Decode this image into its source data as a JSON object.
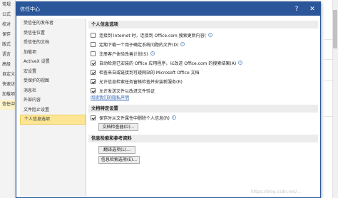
{
  "background": {
    "nav_items": [
      "常规",
      "公式",
      "校对",
      "保存",
      "版式",
      "语言",
      "高级",
      "自定义",
      "快速访问",
      "加载项",
      "信任中心"
    ],
    "selected_index": 10
  },
  "dialog": {
    "title": "信任中心",
    "help_icon": "?",
    "close_icon": "✕"
  },
  "nav": {
    "items": [
      "受信任的发布者",
      "受信任位置",
      "受信任的文档",
      "加载项",
      "ActiveX 设置",
      "宏设置",
      "受保护的视图",
      "消息栏",
      "外部内容",
      "文件阻止设置",
      "个人信息选项"
    ],
    "selected_index": 10
  },
  "personal": {
    "header": "个人信息选项",
    "options": [
      {
        "label": "连接到 Internet 时，连接到 Office.com 搜索更新内容(",
        "checked": false,
        "info": true
      },
      {
        "label": "定期下载一个用于确定系统问题的文件(D)",
        "checked": false,
        "info": true
      },
      {
        "label": "注册客户体验改善计划(S)",
        "checked": false,
        "info": true
      },
      {
        "label": "自动检测已安装的 Office 应用程序，以改进 Office.com 的搜索结果(A)",
        "checked": true,
        "info": true
      },
      {
        "label": "检查来自或链接到可疑网站的 Microsoft Office 文档",
        "checked": true,
        "info": false
      },
      {
        "label": "允许信息检索任务窗格检查并安装新服务(R)",
        "checked": true,
        "info": false
      },
      {
        "label": "允许发送文件以改进文件验证",
        "checked": true,
        "info": false
      }
    ],
    "privacy_link": "阅读我们的隐私声明"
  },
  "doc_specific": {
    "header": "文档特定设置",
    "remove_on_save": {
      "label": "保存时从文件属性中删除个人信息(R)",
      "checked": true,
      "info": true
    },
    "inspector_button": "文档检查器(D)..."
  },
  "research": {
    "header": "信息检索和参考资料",
    "translate_button": "翻译选项(L)...",
    "research_button": "信息检索选项(E)..."
  },
  "watermark": "https://blog.csdn.net/..."
}
